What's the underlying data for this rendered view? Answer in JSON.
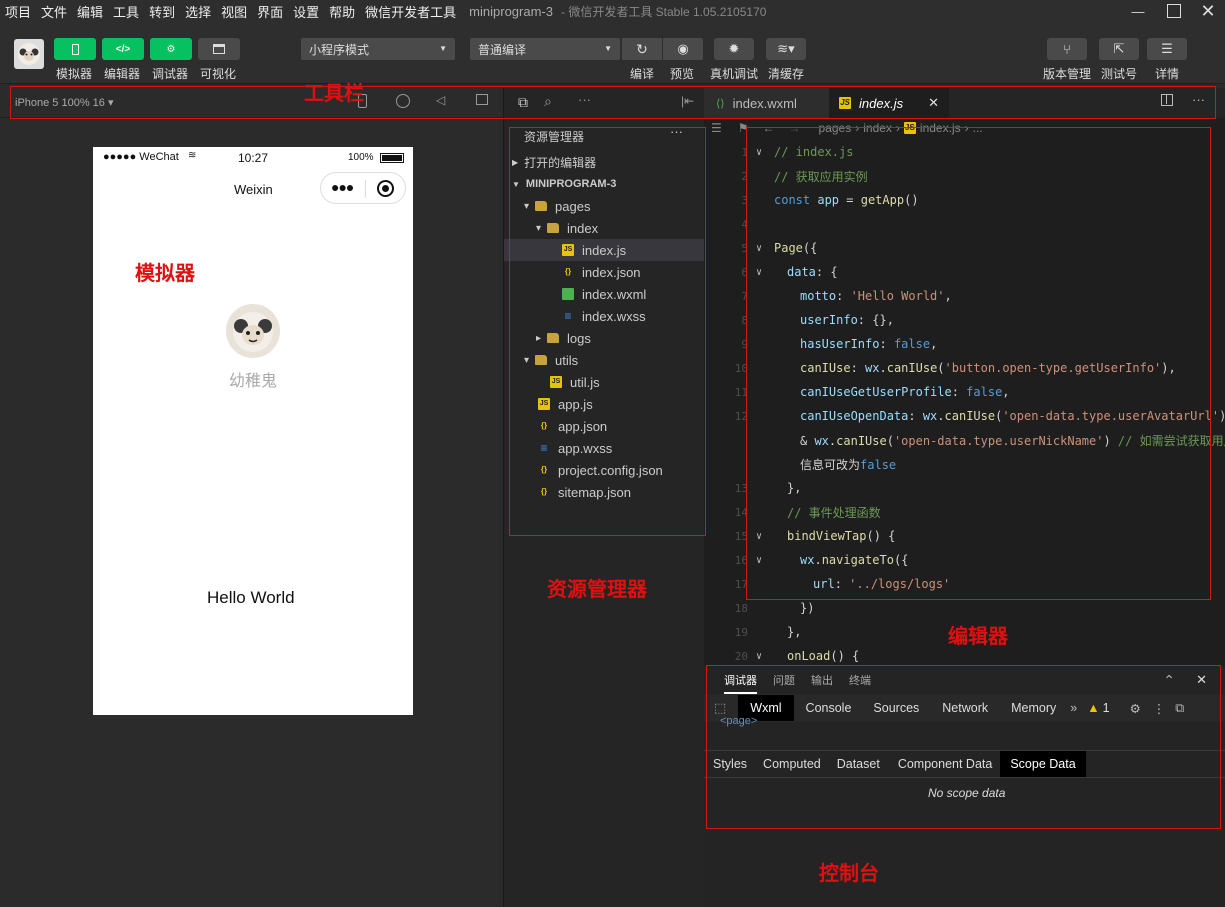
{
  "menubar": {
    "items": [
      "项目",
      "文件",
      "编辑",
      "工具",
      "转到",
      "选择",
      "视图",
      "界面",
      "设置",
      "帮助",
      "微信开发者工具"
    ],
    "project": "miniprogram-3",
    "window_title": "- 微信开发者工具 Stable 1.05.2105170"
  },
  "toolbar": {
    "buttons_left": [
      {
        "label": "模拟器",
        "icon": "phone-icon"
      },
      {
        "label": "编辑器",
        "icon": "code-icon"
      },
      {
        "label": "调试器",
        "icon": "debug-icon"
      },
      {
        "label": "可视化",
        "icon": "layout-icon"
      }
    ],
    "mode_select": "小程序模式",
    "compile_select": "普通编译",
    "compile_label": "编译",
    "preview_label": "预览",
    "remote_debug_label": "真机调试",
    "clear_cache_label": "清缓存",
    "version_label": "版本管理",
    "testid_label": "测试号",
    "details_label": "详情"
  },
  "simulator": {
    "device": "iPhone 5 100% 16 ▾",
    "status_carrier": "●●●●● WeChat",
    "status_time": "10:27",
    "status_battery": "100%",
    "nav_title": "Weixin",
    "nickname": "幼稚鬼",
    "hello": "Hello World"
  },
  "explorer": {
    "title": "资源管理器",
    "open_editors": "打开的编辑器",
    "project": "MINIPROGRAM-3",
    "files": [
      {
        "name": "pages",
        "depth": 1,
        "type": "folder-open",
        "arrow": "▾"
      },
      {
        "name": "index",
        "depth": 2,
        "type": "folder-open",
        "arrow": "▾"
      },
      {
        "name": "index.js",
        "depth": 3,
        "type": "js",
        "arrow": ""
      },
      {
        "name": "index.json",
        "depth": 3,
        "type": "json",
        "arrow": ""
      },
      {
        "name": "index.wxml",
        "depth": 3,
        "type": "wxml",
        "arrow": ""
      },
      {
        "name": "index.wxss",
        "depth": 3,
        "type": "wxss",
        "arrow": ""
      },
      {
        "name": "logs",
        "depth": 2,
        "type": "folder",
        "arrow": "▸"
      },
      {
        "name": "utils",
        "depth": 1,
        "type": "folder-open",
        "arrow": "▾"
      },
      {
        "name": "util.js",
        "depth": 2,
        "type": "js",
        "arrow": ""
      },
      {
        "name": "app.js",
        "depth": 1,
        "type": "js",
        "arrow": ""
      },
      {
        "name": "app.json",
        "depth": 1,
        "type": "json",
        "arrow": ""
      },
      {
        "name": "app.wxss",
        "depth": 1,
        "type": "wxss",
        "arrow": ""
      },
      {
        "name": "project.config.json",
        "depth": 1,
        "type": "json",
        "arrow": ""
      },
      {
        "name": "sitemap.json",
        "depth": 1,
        "type": "json",
        "arrow": ""
      }
    ]
  },
  "editor": {
    "tabs": [
      {
        "label": "index.wxml",
        "active": false
      },
      {
        "label": "index.js",
        "active": true
      }
    ],
    "breadcrumb": [
      "pages",
      "index",
      "index.js",
      "..."
    ],
    "lines": [
      {
        "n": "1",
        "code": "// index.js"
      },
      {
        "n": "2",
        "code": "// 获取应用实例"
      },
      {
        "n": "3",
        "code": "const app = getApp()"
      },
      {
        "n": "4",
        "code": ""
      },
      {
        "n": "5",
        "code": "Page({"
      },
      {
        "n": "6",
        "code": "  data: {"
      },
      {
        "n": "7",
        "code": "    motto: 'Hello World',"
      },
      {
        "n": "8",
        "code": "    userInfo: {},"
      },
      {
        "n": "9",
        "code": "    hasUserInfo: false,"
      },
      {
        "n": "10",
        "code": "    canIUse: wx.canIUse('button.open-type.getUserInfo'),"
      },
      {
        "n": "11",
        "code": "    canIUseGetUserProfile: false,"
      },
      {
        "n": "12",
        "code": "    canIUseOpenData: wx.canIUse('open-data.type.userAvatarUrl') &"
      },
      {
        "n": "",
        "code": "    & wx.canIUse('open-data.type.userNickName') // 如需尝试获取用户"
      },
      {
        "n": "",
        "code": "    信息可改为false"
      },
      {
        "n": "13",
        "code": "  },"
      },
      {
        "n": "14",
        "code": "  // 事件处理函数"
      },
      {
        "n": "15",
        "code": "  bindViewTap() {"
      },
      {
        "n": "16",
        "code": "    wx.navigateTo({"
      },
      {
        "n": "17",
        "code": "      url: '../logs/logs'"
      },
      {
        "n": "18",
        "code": "    })"
      },
      {
        "n": "19",
        "code": "  },"
      },
      {
        "n": "20",
        "code": "  onLoad() {"
      }
    ]
  },
  "console": {
    "tabs": [
      "调试器",
      "问题",
      "输出",
      "终端"
    ],
    "devtabs": [
      "Wxml",
      "Console",
      "Sources",
      "Network",
      "Memory"
    ],
    "warn_count": "1",
    "page_tag": "<page>",
    "subtabs": [
      "Styles",
      "Computed",
      "Dataset",
      "Component Data",
      "Scope Data"
    ],
    "empty": "No scope data"
  },
  "annotations": {
    "toolbar": "工具栏",
    "simulator": "模拟器",
    "explorer": "资源管理器",
    "editor": "编辑器",
    "console": "控制台"
  }
}
